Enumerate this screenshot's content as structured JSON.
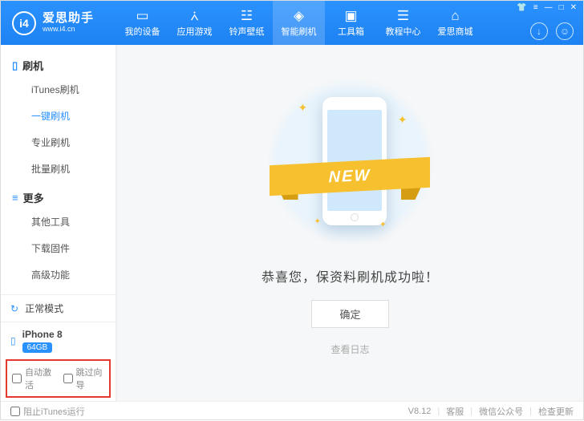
{
  "brand": {
    "glyph": "i4",
    "cn": "爱思助手",
    "en": "www.i4.cn"
  },
  "nav": [
    {
      "label": "我的设备"
    },
    {
      "label": "应用游戏"
    },
    {
      "label": "铃声壁纸"
    },
    {
      "label": "智能刷机"
    },
    {
      "label": "工具箱"
    },
    {
      "label": "教程中心"
    },
    {
      "label": "爱思商城"
    }
  ],
  "nav_active_index": 3,
  "sidebar": {
    "group1": {
      "title": "刷机",
      "items": [
        "iTunes刷机",
        "一键刷机",
        "专业刷机",
        "批量刷机"
      ],
      "active_index": 1
    },
    "group2": {
      "title": "更多",
      "items": [
        "其他工具",
        "下载固件",
        "高级功能"
      ]
    }
  },
  "mode": {
    "label": "正常模式"
  },
  "device": {
    "name": "iPhone 8",
    "capacity": "64GB"
  },
  "options": {
    "auto_activate": "自动激活",
    "skip_guide": "跳过向导"
  },
  "main": {
    "ribbon": "NEW",
    "success": "恭喜您，保资料刷机成功啦！",
    "ok": "确定",
    "log": "查看日志"
  },
  "footer": {
    "block_itunes": "阻止iTunes运行",
    "version": "V8.12",
    "support": "客服",
    "wechat": "微信公众号",
    "check_update": "检查更新"
  }
}
